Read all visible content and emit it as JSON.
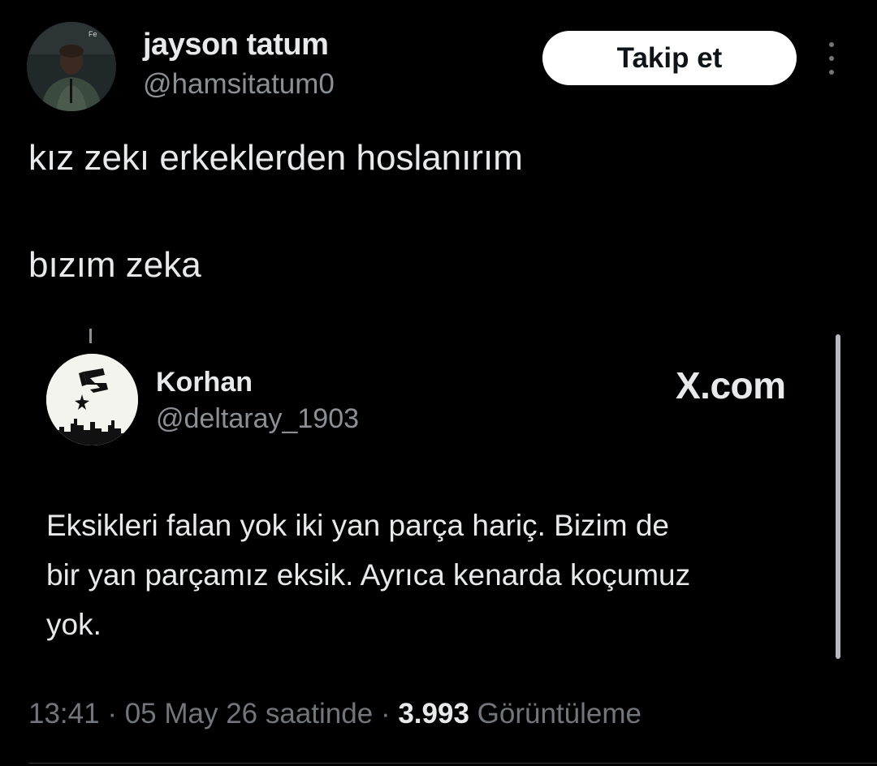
{
  "author": {
    "display_name": "jayson tatum",
    "handle": "@hamsitatum0",
    "avatar": "profile-photo-icon"
  },
  "follow_button": {
    "label": "Takip et"
  },
  "more_menu": {
    "icon": "vertical-ellipsis-icon"
  },
  "tweet": {
    "lines": [
      "kız zekı erkeklerden hoslanırım",
      "bızım zeka"
    ]
  },
  "quoted": {
    "display_name": "Korhan",
    "handle": "@deltaray_1903",
    "avatar": "spurs-logo-icon",
    "source": "X.com",
    "lines": [
      "Eksikleri falan yok iki yan parça hariç. Bizim de",
      "bir yan parçamız eksik. Ayrıca kenarda koçumuz",
      "yok."
    ]
  },
  "meta": {
    "time": "13:41",
    "sep1": "·",
    "date": "05 May 26 saatinde",
    "sep2": "·",
    "views_count": "3.993",
    "views_label": "Görüntüleme"
  },
  "colors": {
    "background": "#000000",
    "text_primary": "#e7e9ea",
    "text_secondary": "#71767b",
    "button_bg": "#ffffff",
    "button_text": "#0f1419"
  }
}
